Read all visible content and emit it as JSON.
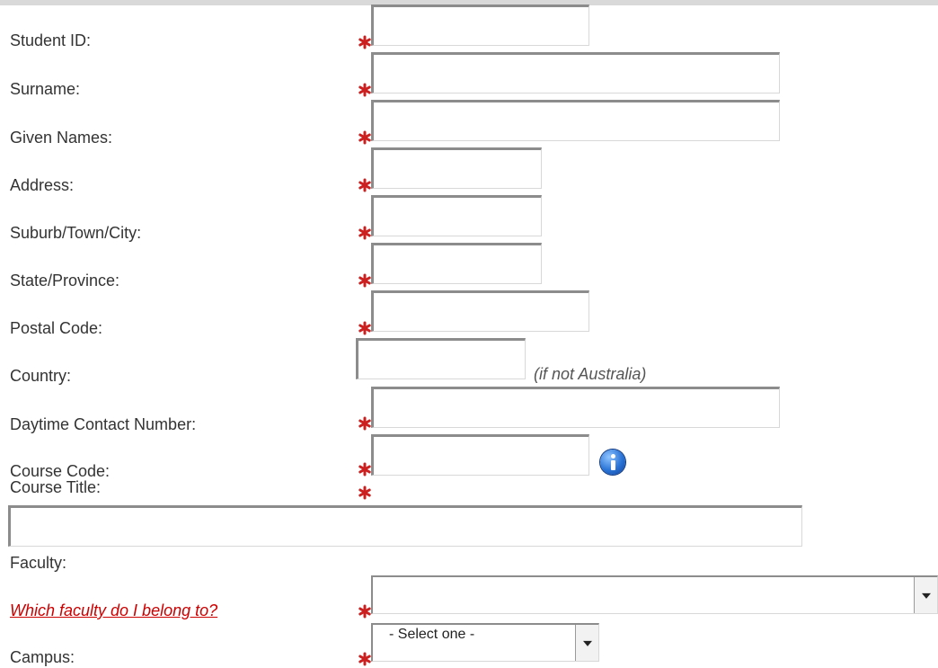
{
  "form": {
    "labels": {
      "student_id": "Student ID:",
      "surname": "Surname:",
      "given_names": "Given Names:",
      "address": "Address:",
      "suburb": "Suburb/Town/City:",
      "state": "State/Province:",
      "postal_code": "Postal Code:",
      "country": "Country:",
      "daytime_contact": "Daytime Contact Number:",
      "course_code": "Course Code:",
      "course_title": "Course Title:",
      "faculty": "Faculty:",
      "campus": "Campus:"
    },
    "values": {
      "student_id": "",
      "surname": "",
      "given_names": "",
      "address": "",
      "suburb": "",
      "state": "",
      "postal_code": "",
      "country": "",
      "daytime_contact": "",
      "course_code": "",
      "course_title": ""
    },
    "country_hint": "(if not Australia)",
    "faculty_help_link": "Which faculty do I belong to?",
    "faculty_select_value": "",
    "campus_select_value": "- Select one -",
    "required_icon": "asterisk-icon",
    "info_icon": "info-icon"
  },
  "colors": {
    "required_asterisk": "#cc1f1f",
    "link": "#cc0000",
    "info_icon": "#2a74d6",
    "top_bar": "#d9d9d9"
  }
}
